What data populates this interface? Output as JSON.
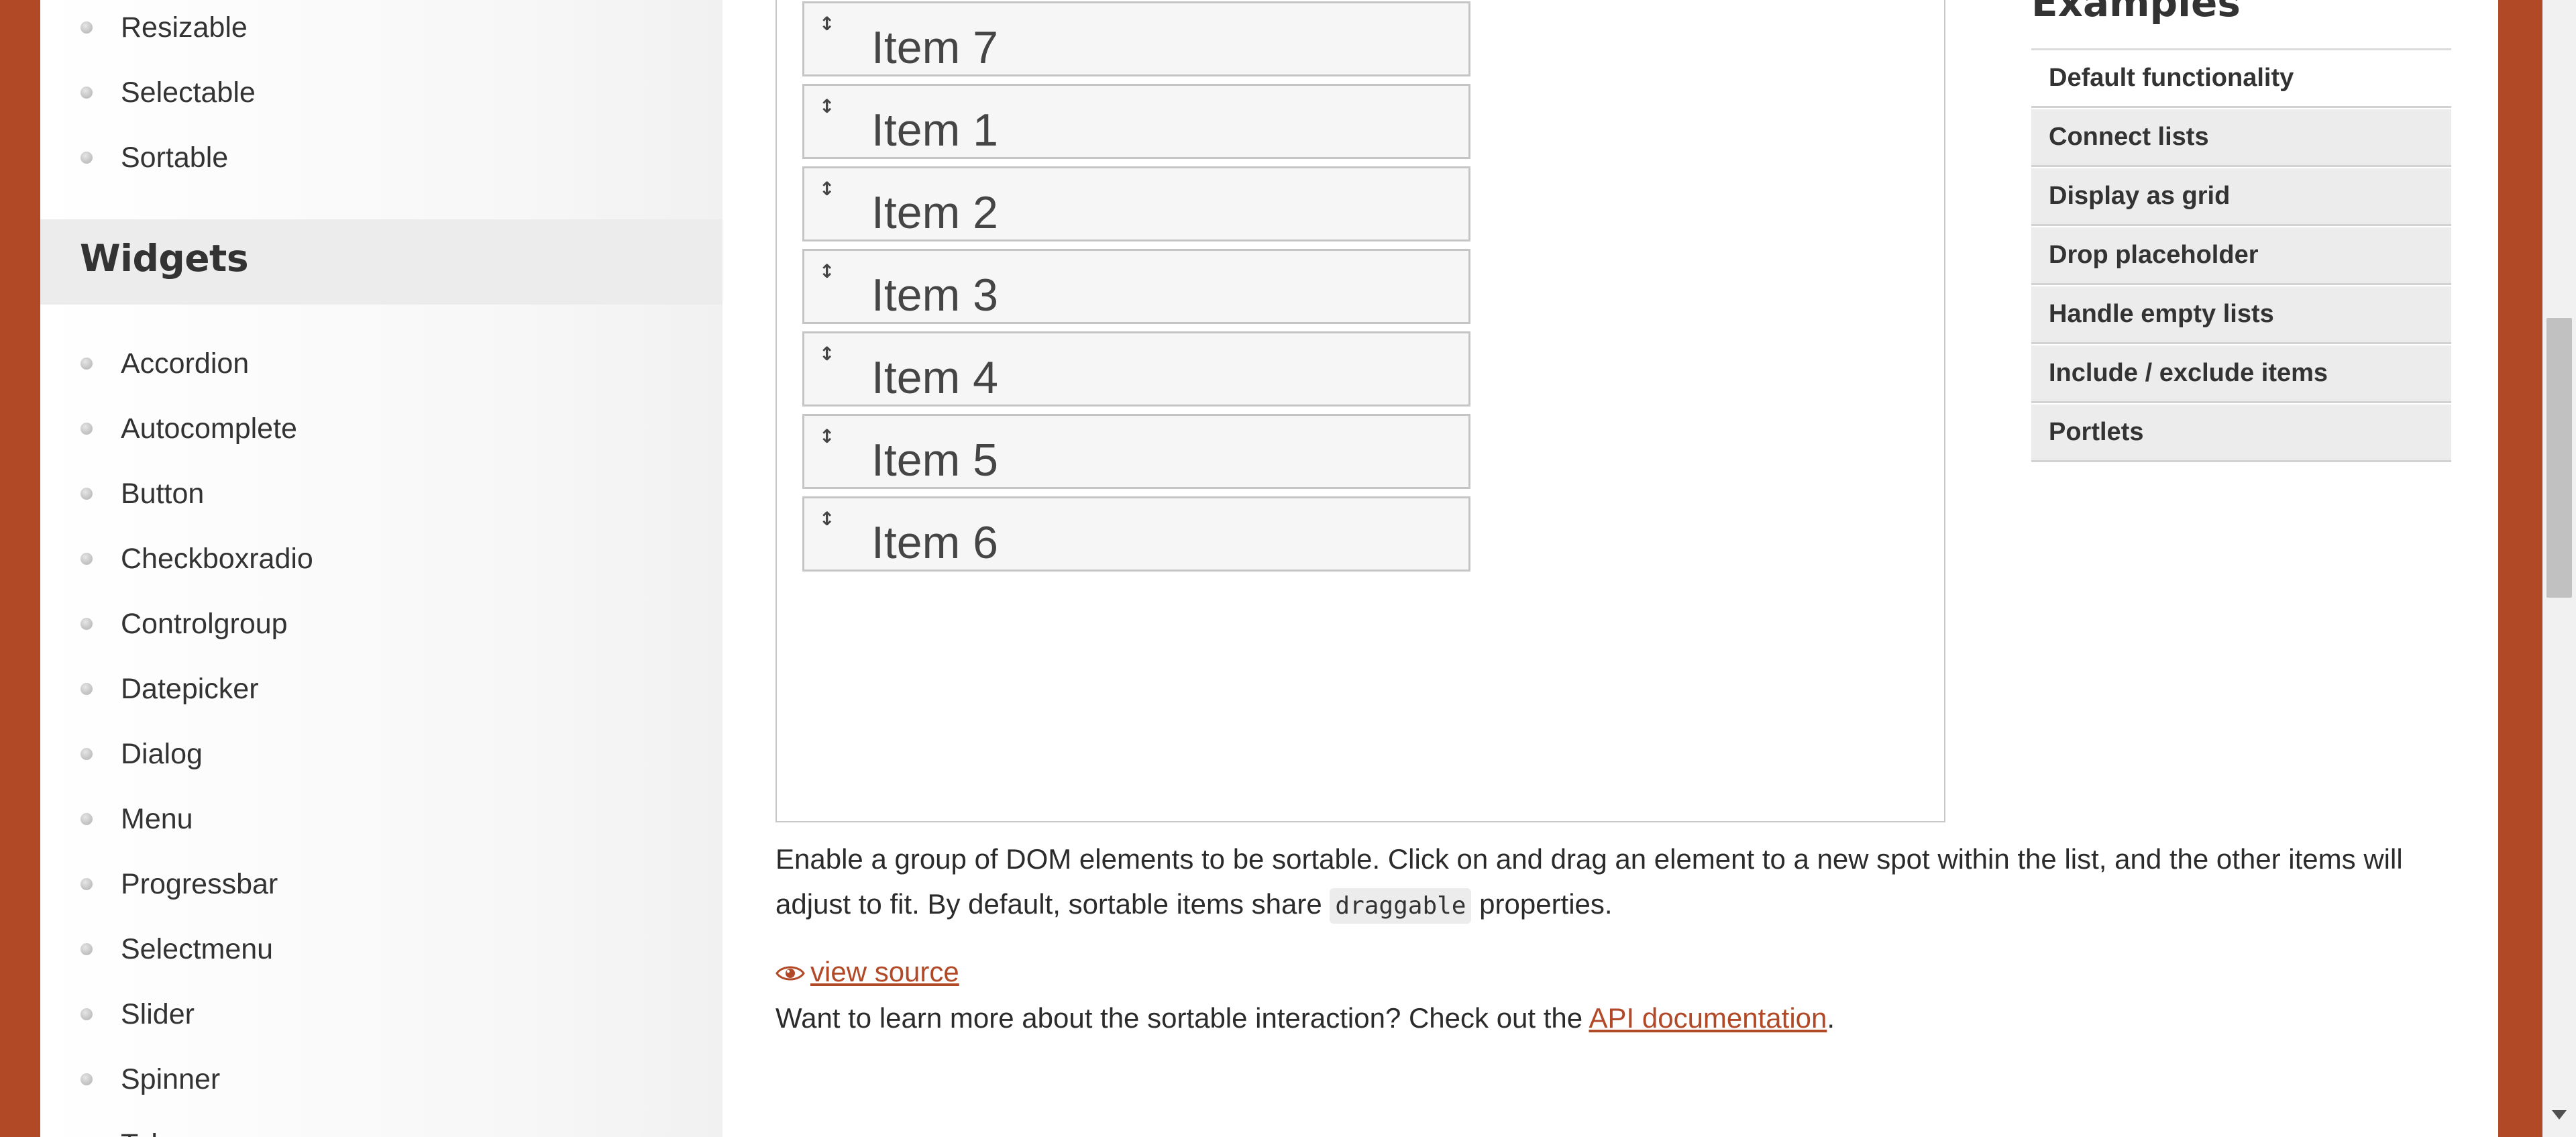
{
  "sidebar": {
    "interactions": [
      "Resizable",
      "Selectable",
      "Sortable"
    ],
    "widgets_heading": "Widgets",
    "widgets": [
      "Accordion",
      "Autocomplete",
      "Button",
      "Checkboxradio",
      "Controlgroup",
      "Datepicker",
      "Dialog",
      "Menu",
      "Progressbar",
      "Selectmenu",
      "Slider",
      "Spinner",
      "Tabs"
    ]
  },
  "demo": {
    "items": [
      "Item 7",
      "Item 1",
      "Item 2",
      "Item 3",
      "Item 4",
      "Item 5",
      "Item 6"
    ],
    "handle_icon": "arrow-up-down-icon"
  },
  "description": {
    "text_before": "Enable a group of DOM elements to be sortable. Click on and drag an element to a new spot within the list, and the other items will adjust to fit. By default, sortable items share ",
    "code": "draggable",
    "text_after": " properties."
  },
  "view_source": {
    "label": "view source",
    "icon": "eye-icon"
  },
  "learn_more": {
    "text": "Want to learn more about the sortable interaction? Check out the ",
    "link": "API documentation",
    "end": "."
  },
  "examples": {
    "heading": "Examples",
    "items": [
      "Default functionality",
      "Connect lists",
      "Display as grid",
      "Drop placeholder",
      "Handle empty lists",
      "Include / exclude items",
      "Portlets"
    ],
    "active_index": 0
  },
  "colors": {
    "accent": "#b24926",
    "page_bg": "#ffffff",
    "item_bg": "#f6f6f6"
  }
}
